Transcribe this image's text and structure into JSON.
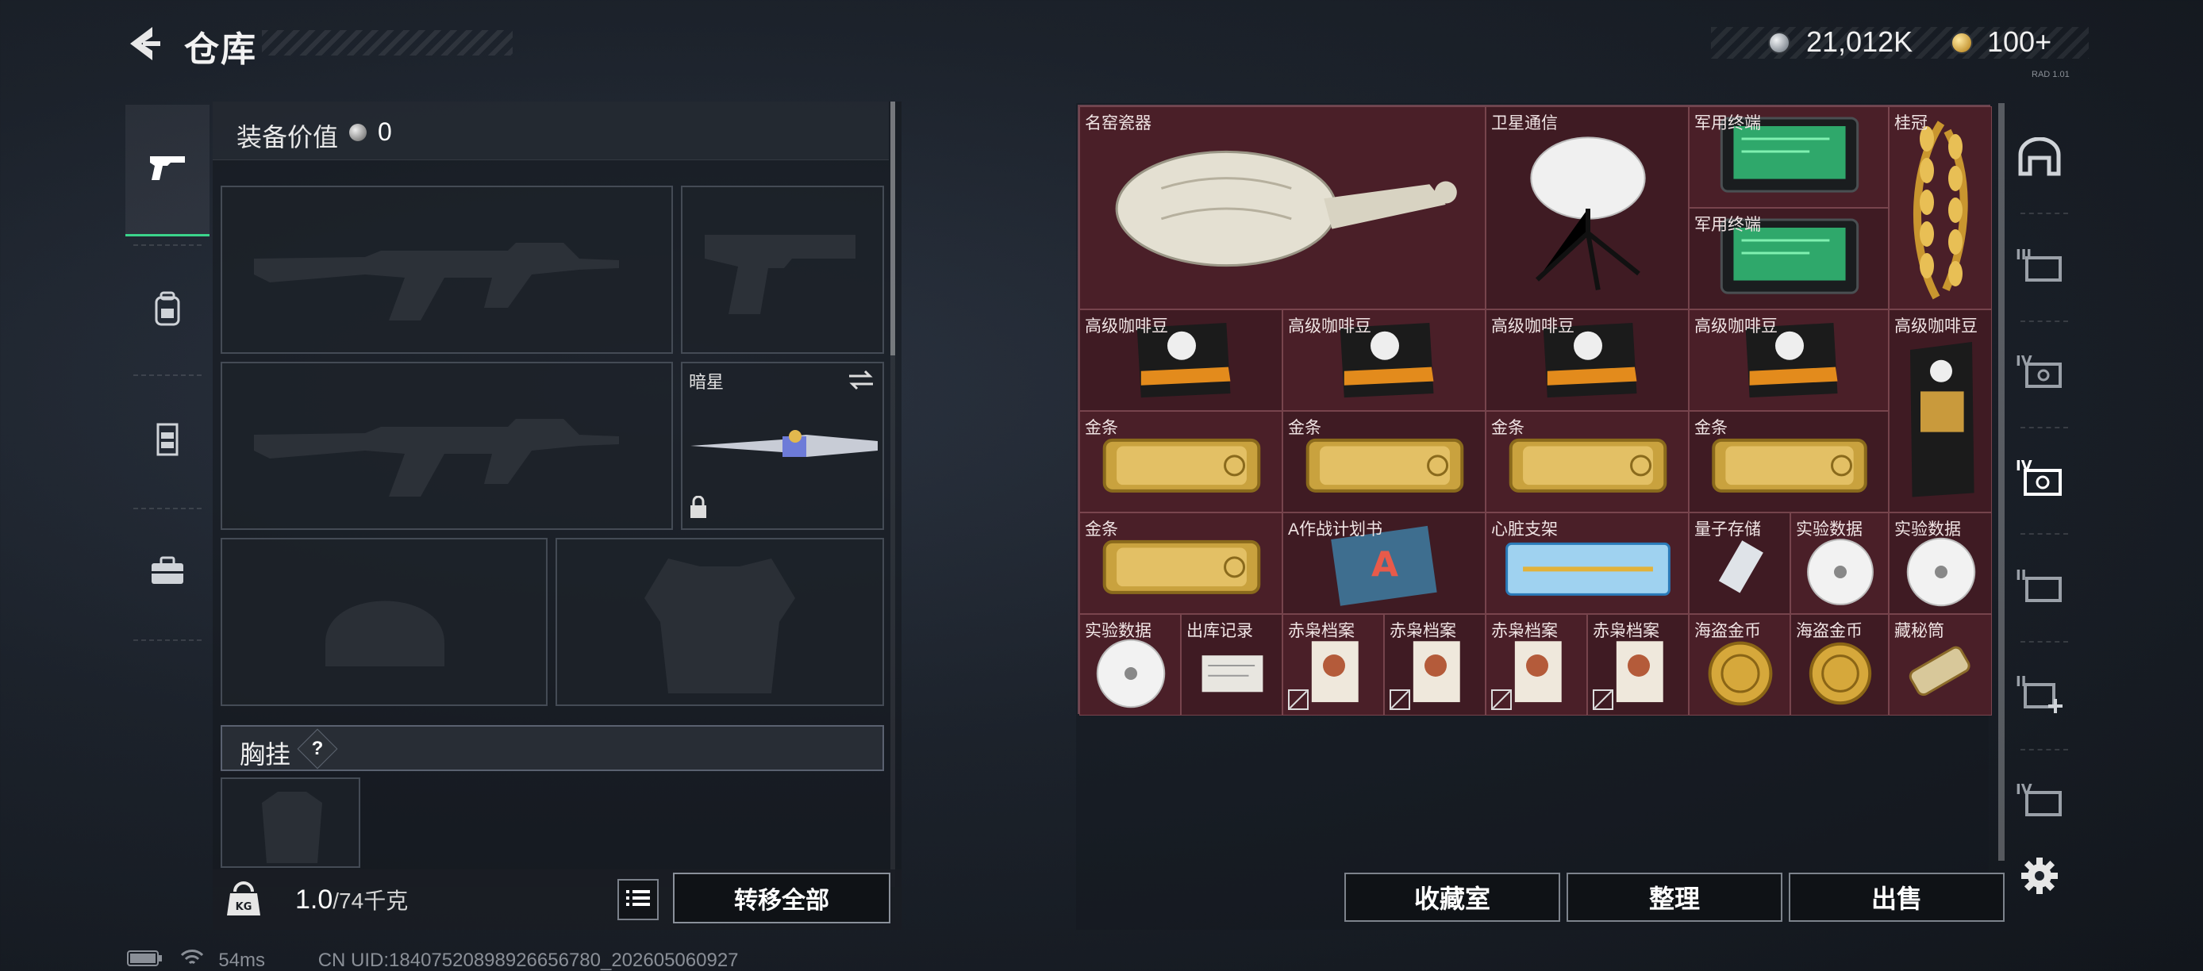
{
  "header": {
    "title": "仓库",
    "silver_amount": "21,012K",
    "gold_amount": "100+",
    "version_tag": "RAD 1.01"
  },
  "equipment": {
    "value_label": "装备价值",
    "value_amount": "0",
    "slots": [
      {
        "name": "primary-weapon-1",
        "label": ""
      },
      {
        "name": "pistol",
        "label": ""
      },
      {
        "name": "primary-weapon-2",
        "label": ""
      },
      {
        "name": "melee",
        "label": "暗星"
      },
      {
        "name": "helmet",
        "label": ""
      },
      {
        "name": "armor",
        "label": ""
      }
    ],
    "chest_label": "胸挂",
    "chest_help": "?",
    "weight_current": "1.0",
    "weight_max": "/74千克",
    "transfer_all": "转移全部"
  },
  "stash": {
    "items": [
      {
        "name": "名窑瓷器",
        "kind": "vase"
      },
      {
        "name": "卫星通信",
        "kind": "dish"
      },
      {
        "name": "军用终端",
        "kind": "terminal"
      },
      {
        "name": "军用终端",
        "kind": "terminal"
      },
      {
        "name": "桂冠",
        "kind": "laurel"
      },
      {
        "name": "高级咖啡豆",
        "kind": "coffee"
      },
      {
        "name": "高级咖啡豆",
        "kind": "coffee"
      },
      {
        "name": "高级咖啡豆",
        "kind": "coffee"
      },
      {
        "name": "高级咖啡豆",
        "kind": "coffee"
      },
      {
        "name": "高级咖啡豆",
        "kind": "coffee-tall"
      },
      {
        "name": "金条",
        "kind": "gold"
      },
      {
        "name": "金条",
        "kind": "gold"
      },
      {
        "name": "金条",
        "kind": "gold"
      },
      {
        "name": "金条",
        "kind": "gold"
      },
      {
        "name": "金条",
        "kind": "gold"
      },
      {
        "name": "A作战计划书",
        "kind": "plan"
      },
      {
        "name": "心脏支架",
        "kind": "stent"
      },
      {
        "name": "量子存储",
        "kind": "usb"
      },
      {
        "name": "实验数据",
        "kind": "disc"
      },
      {
        "name": "实验数据",
        "kind": "disc"
      },
      {
        "name": "实验数据",
        "kind": "disc"
      },
      {
        "name": "出库记录",
        "kind": "paper"
      },
      {
        "name": "赤枭档案",
        "kind": "file"
      },
      {
        "name": "赤枭档案",
        "kind": "file"
      },
      {
        "name": "赤枭档案",
        "kind": "file"
      },
      {
        "name": "赤枭档案",
        "kind": "file"
      },
      {
        "name": "海盗金币",
        "kind": "coin"
      },
      {
        "name": "海盗金币",
        "kind": "coin"
      },
      {
        "name": "藏秘筒",
        "kind": "cryptex"
      }
    ],
    "buttons": {
      "collection": "收藏室",
      "sort": "整理",
      "sell": "出售"
    }
  },
  "status": {
    "ping": "54ms",
    "uid": "CN UID:18407520898926656780_202605060927"
  },
  "colors": {
    "accent_green": "#3bd48b",
    "stash_bg": "#4a1f28",
    "gold_coin": "#c89a3a"
  },
  "icons": {
    "tab_weapons": "pistol-icon",
    "tab_backpack": "backpack-icon",
    "tab_vest": "vest-icon",
    "tab_case": "briefcase-icon",
    "settings": "gear-icon"
  }
}
